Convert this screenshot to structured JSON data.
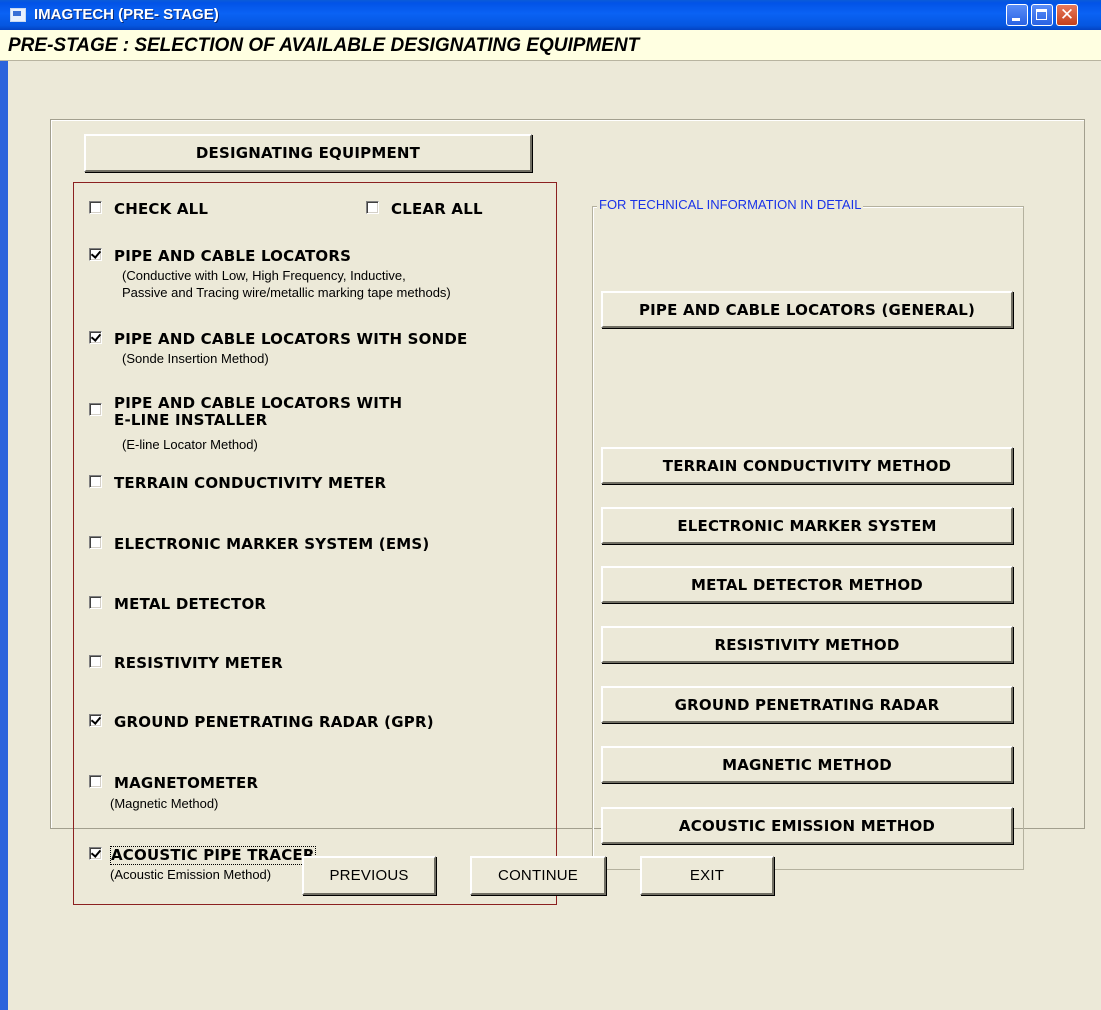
{
  "window": {
    "title": "IMAGTECH (PRE- STAGE)"
  },
  "header": {
    "title": "PRE-STAGE : SELECTION OF AVAILABLE DESIGNATING EQUIPMENT"
  },
  "equipment": {
    "heading_button": "DESIGNATING EQUIPMENT",
    "check_all": {
      "label": "CHECK ALL",
      "checked": false
    },
    "clear_all": {
      "label": "CLEAR ALL",
      "checked": false
    },
    "items": [
      {
        "label": "PIPE AND CABLE LOCATORS",
        "note": "(Conductive with Low, High Frequency, Inductive,\nPassive and Tracing wire/metallic marking tape methods)",
        "checked": true
      },
      {
        "label": "PIPE AND CABLE LOCATORS WITH SONDE",
        "note": "(Sonde Insertion Method)",
        "checked": true
      },
      {
        "label": "PIPE AND CABLE LOCATORS WITH\nE-LINE INSTALLER",
        "note": "(E-line Locator Method)",
        "checked": false
      },
      {
        "label": "TERRAIN CONDUCTIVITY METER",
        "note": "",
        "checked": false
      },
      {
        "label": "ELECTRONIC MARKER SYSTEM (EMS)",
        "note": "",
        "checked": false
      },
      {
        "label": "METAL DETECTOR",
        "note": "",
        "checked": false
      },
      {
        "label": "RESISTIVITY METER",
        "note": "",
        "checked": false
      },
      {
        "label": "GROUND PENETRATING RADAR (GPR)",
        "note": "",
        "checked": true
      },
      {
        "label": "MAGNETOMETER",
        "note": "(Magnetic Method)",
        "checked": false
      },
      {
        "label": "ACOUSTIC PIPE TRACER",
        "note": "(Acoustic Emission Method)",
        "checked": true
      }
    ]
  },
  "technical_info": {
    "legend": "FOR TECHNICAL INFORMATION IN DETAIL",
    "buttons": [
      "PIPE AND CABLE LOCATORS (GENERAL)",
      "TERRAIN CONDUCTIVITY METHOD",
      "ELECTRONIC MARKER SYSTEM",
      "METAL DETECTOR METHOD",
      "RESISTIVITY METHOD",
      "GROUND PENETRATING RADAR",
      "MAGNETIC METHOD",
      "ACOUSTIC EMISSION METHOD"
    ]
  },
  "footer": {
    "previous": "PREVIOUS",
    "continue": "CONTINUE",
    "exit": "EXIT"
  },
  "colors": {
    "title_bar": "#0A5BD8",
    "header_bg": "#FFFFE1",
    "window_bg": "#ECE9D8",
    "equipment_border": "#8B2020",
    "legend_text": "#1A33E8"
  }
}
